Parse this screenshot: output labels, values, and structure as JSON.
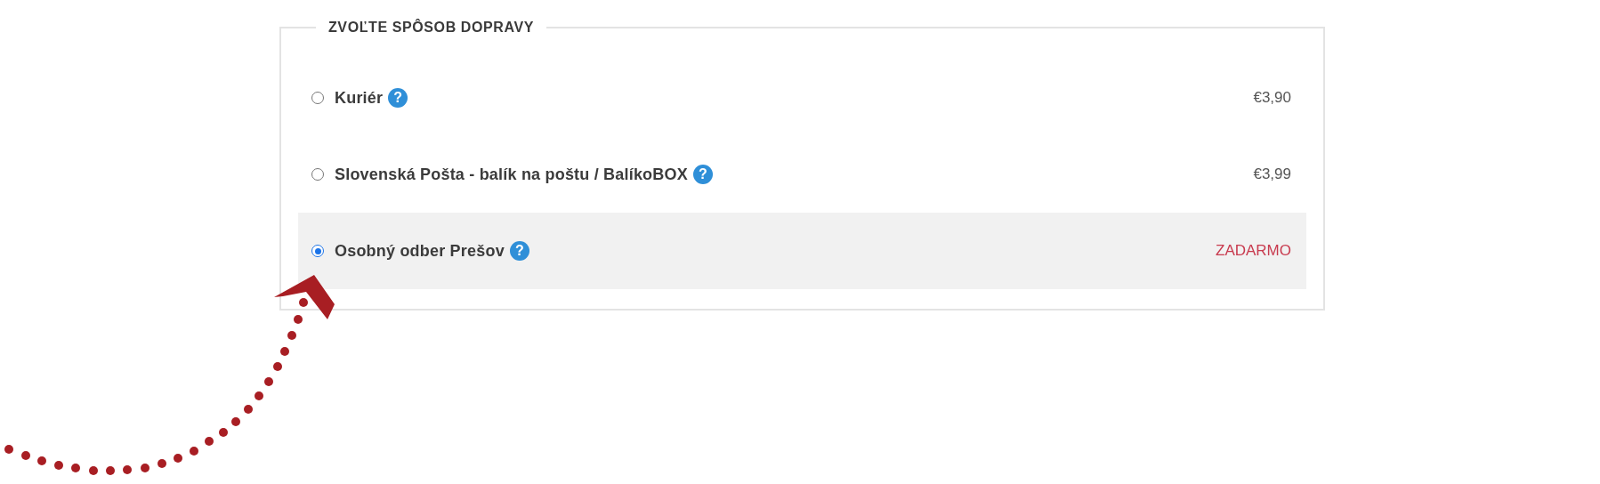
{
  "shipping": {
    "legend": "ZVOĽTE SPÔSOB DOPRAVY",
    "options": [
      {
        "label": "Kuriér",
        "help": "?",
        "price": "€3,90",
        "free": false,
        "selected": false
      },
      {
        "label": "Slovenská Pošta - balík na poštu / BalíkoBOX",
        "help": "?",
        "price": "€3,99",
        "free": false,
        "selected": false
      },
      {
        "label": "Osobný odber Prešov",
        "help": "?",
        "price": "ZADARMO",
        "free": true,
        "selected": true
      }
    ]
  }
}
